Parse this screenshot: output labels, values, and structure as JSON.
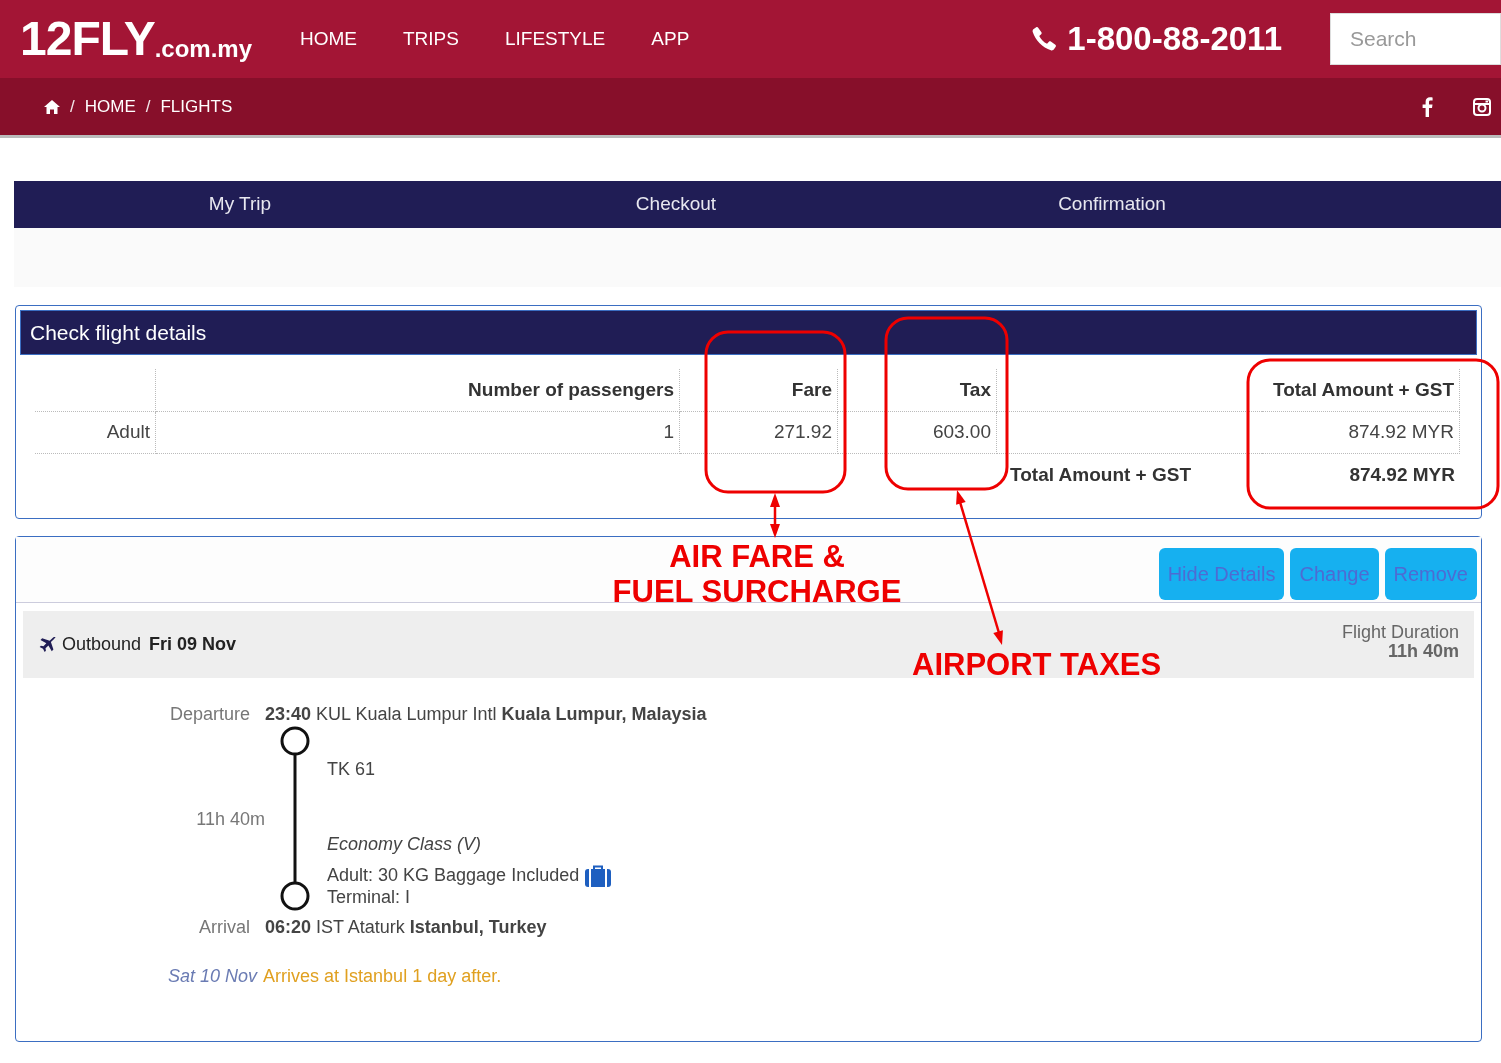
{
  "header": {
    "logo": "12FLY",
    "logo_suffix": ".com.my",
    "nav": [
      "HOME",
      "TRIPS",
      "LIFESTYLE",
      "APP"
    ],
    "phone": "1-800-88-2011",
    "search": {
      "placeholder": "Search"
    }
  },
  "breadcrumb": {
    "separator": "/",
    "items": [
      "HOME",
      "FLIGHTS"
    ]
  },
  "steps": [
    "My Trip",
    "Checkout",
    "Confirmation"
  ],
  "fare_table": {
    "title": "Check flight details",
    "columns": [
      "Number of passengers",
      "Fare",
      "Tax",
      "Total Amount + GST"
    ],
    "rows": [
      {
        "passenger_type": "Adult",
        "passengers": "1",
        "fare": "271.92",
        "tax": "603.00",
        "total": "874.92 MYR"
      }
    ],
    "total": {
      "label": "Total Amount + GST",
      "value": "874.92 MYR"
    }
  },
  "flight": {
    "buttons": [
      "Hide Details",
      "Change",
      "Remove"
    ],
    "direction": "Outbound",
    "date": "Fri 09 Nov",
    "duration_label": "Flight Duration",
    "duration": "11h 40m",
    "departure": {
      "label": "Departure",
      "time": "23:40",
      "airport": "KUL Kuala Lumpur Intl",
      "city": "Kuala Lumpur, Malaysia"
    },
    "flight_number": "TK 61",
    "leg_duration": "11h 40m",
    "cabin": "Economy Class (V)",
    "baggage": "Adult: 30 KG Baggage Included",
    "terminal": "Terminal: I",
    "arrival": {
      "label": "Arrival",
      "time": "06:20",
      "airport": "IST Ataturk",
      "city": "Istanbul, Turkey"
    },
    "arrival_date": "Sat 10 Nov",
    "arrival_note": "Arrives at Istanbul 1 day after."
  },
  "annotations": {
    "fare_label": [
      "AIR FARE &",
      "FUEL SURCHARGE"
    ],
    "tax_label": "AIRPORT TAXES"
  }
}
